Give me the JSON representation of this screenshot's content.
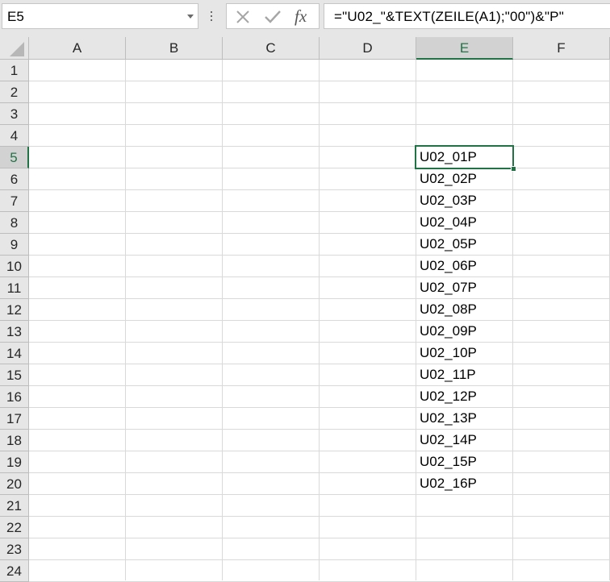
{
  "name_box": {
    "value": "E5"
  },
  "formula_bar": {
    "formula": "=\"U02_\"&TEXT(ZEILE(A1);\"00\")&\"P\"",
    "fx_label": "fx"
  },
  "sheet": {
    "columns": [
      "A",
      "B",
      "C",
      "D",
      "E",
      "F"
    ],
    "selected_column": "E",
    "rows": [
      "1",
      "2",
      "3",
      "4",
      "5",
      "6",
      "7",
      "8",
      "9",
      "10",
      "11",
      "12",
      "13",
      "14",
      "15",
      "16",
      "17",
      "18",
      "19",
      "20",
      "21",
      "22",
      "23",
      "24"
    ],
    "selected_row": "5",
    "column_e_values": [
      "U02_01P",
      "U02_02P",
      "U02_03P",
      "U02_04P",
      "U02_05P",
      "U02_06P",
      "U02_07P",
      "U02_08P",
      "U02_09P",
      "U02_10P",
      "U02_11P",
      "U02_12P",
      "U02_13P",
      "U02_14P",
      "U02_15P",
      "U02_16P"
    ],
    "column_e_start_row": 5
  },
  "colors": {
    "accent": "#217346",
    "header_bg": "#e6e6e6",
    "gridline": "#d9d9d9"
  },
  "icons": [
    "dropdown-arrow-icon",
    "more-options-icon",
    "cancel-icon",
    "enter-icon",
    "insert-function-icon"
  ]
}
